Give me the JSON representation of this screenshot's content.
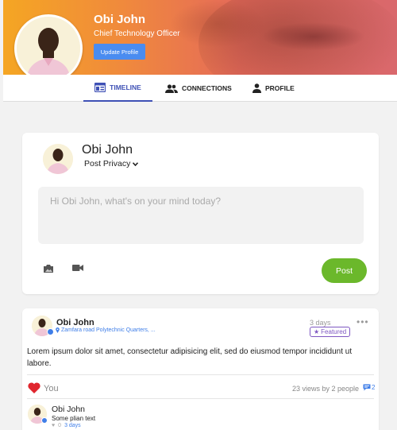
{
  "profile": {
    "name": "Obi John",
    "title": "Chief Technology Officer",
    "update_button": "Update Profile"
  },
  "tabs": [
    {
      "label": "TIMELINE",
      "icon": "timeline-icon",
      "active": true
    },
    {
      "label": "CONNECTIONS",
      "icon": "people-icon",
      "active": false
    },
    {
      "label": "PROFILE",
      "icon": "person-icon",
      "active": false
    }
  ],
  "composer": {
    "name": "Obi John",
    "privacy_label": "Post Privacy",
    "placeholder": "Hi Obi John, what's on your mind today?",
    "post_button": "Post"
  },
  "post": {
    "author": "Obi John",
    "location": "Zamfara road Polytechnic Quarters, ...",
    "time": "3 days",
    "featured_label": "Featured",
    "body": "Lorem ipsum dolor sit amet, consectetur adipisicing elit, sed do eiusmod tempor incididunt ut labore.",
    "like_label": "You",
    "views_text": "23 views by 2 people",
    "comment_count": "2",
    "comment": {
      "author": "Obi John",
      "text": "Some plian text",
      "likes": "0",
      "time": "3 days"
    }
  },
  "colors": {
    "accent": "#3f51b5",
    "post_button": "#6bb82b",
    "update_button": "#4a8cf0",
    "featured": "#7e57c2",
    "heart": "#e0262e"
  }
}
